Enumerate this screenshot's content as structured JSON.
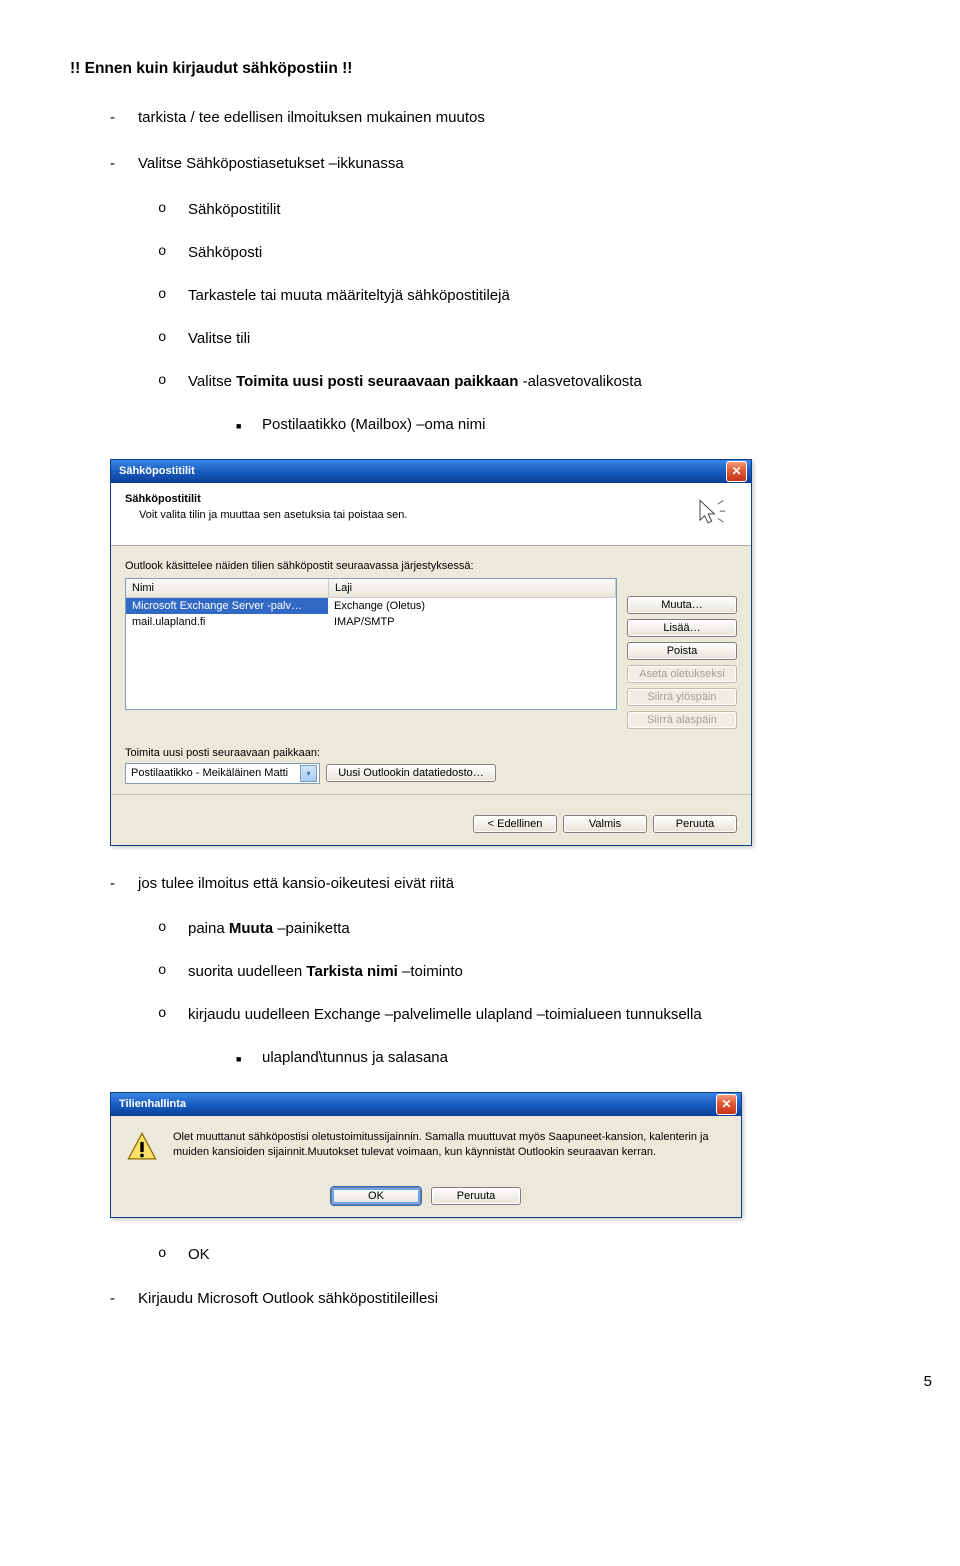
{
  "heading": "!! Ennen kuin kirjaudut sähköpostiin !!",
  "l1_a": "tarkista / tee edellisen ilmoituksen mukainen muutos",
  "l1_b": "Valitse Sähköpostiasetukset –ikkunassa",
  "l2_a": "Sähköpostitilit",
  "l2_b": "Sähköposti",
  "l2_c": "Tarkastele tai muuta määriteltyjä sähköpostitilejä",
  "l2_d": "Valitse tili",
  "l2_e_prefix": "Valitse ",
  "l2_e_bold": "Toimita uusi posti seuraavaan paikkaan",
  "l2_e_suffix": " -alasvetovalikosta",
  "l3_a": "Postilaatikko (Mailbox) –oma nimi",
  "l1_c": "jos tulee ilmoitus että kansio-oikeutesi eivät riitä",
  "l2_f_prefix": "paina ",
  "l2_f_bold": "Muuta",
  "l2_f_suffix": " –painiketta",
  "l2_g_prefix": "suorita uudelleen ",
  "l2_g_bold": "Tarkista nimi",
  "l2_g_suffix": " –toiminto",
  "l2_h": "kirjaudu uudelleen Exchange –palvelimelle ulapland –toimialueen tunnuksella",
  "l3_b": "ulapland\\tunnus ja salasana",
  "l2_i": "OK",
  "l1_d": "Kirjaudu Microsoft Outlook sähköpostitileillesi",
  "dialog1": {
    "title": "Sähköpostitilit",
    "header_title": "Sähköpostitilit",
    "header_sub": "Voit valita tilin ja muuttaa sen asetuksia tai poistaa sen.",
    "body_intro": "Outlook käsittelee näiden tilien sähköpostit seuraavassa järjestyksessä:",
    "col_name": "Nimi",
    "col_type": "Laji",
    "row1_name": "Microsoft Exchange Server -palv…",
    "row1_type": "Exchange (Oletus)",
    "row2_name": "mail.ulapland.fi",
    "row2_type": "IMAP/SMTP",
    "btn_change": "Muuta…",
    "btn_add": "Lisää…",
    "btn_remove": "Poista",
    "btn_default": "Aseta oletukseksi",
    "btn_up": "Siirrä ylöspäin",
    "btn_down": "Siirrä alaspäin",
    "deliver_label": "Toimita uusi posti seuraavaan paikkaan:",
    "deliver_value": "Postilaatikko - Meikäläinen Matti",
    "btn_newfile": "Uusi Outlookin datatiedosto…",
    "btn_back": "< Edellinen",
    "btn_finish": "Valmis",
    "btn_cancel": "Peruuta"
  },
  "dialog2": {
    "title": "Tilienhallinta",
    "msg": "Olet muuttanut sähköpostisi oletustoimitussijainnin. Samalla muuttuvat myös Saapuneet-kansion, kalenterin ja muiden kansioiden sijainnit.Muutokset tulevat voimaan, kun käynnistät Outlookin seuraavan kerran.",
    "ok": "OK",
    "cancel": "Peruuta"
  },
  "page_number": "5"
}
